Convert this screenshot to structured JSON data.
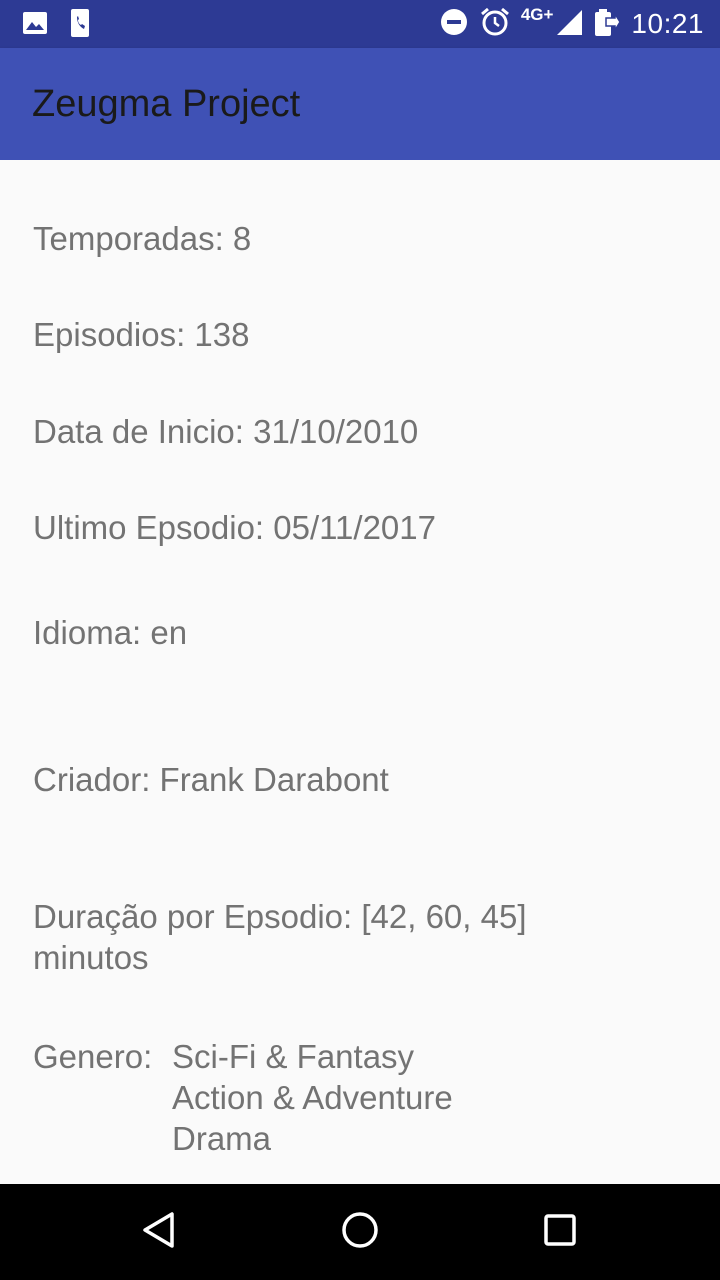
{
  "status_bar": {
    "time": "10:21",
    "network": "4G+",
    "icons": [
      "gallery-icon",
      "phone-file-icon",
      "do-not-disturb-icon",
      "alarm-icon",
      "signal-icon",
      "battery-charging-icon"
    ]
  },
  "app_bar": {
    "title": "Zeugma Project",
    "color": "#3f51b5",
    "status_color": "#2d3a94"
  },
  "details": {
    "seasons": "Temporadas: 8",
    "episodes": "Episodios: 138",
    "start_date": "Data de Inicio: 31/10/2010",
    "last_episode": "Ultimo Epsodio: 05/11/2017",
    "language": "Idioma: en",
    "creator": "Criador: Frank Darabont",
    "duration_line1": "Duração por Epsodio: [42, 60, 45]",
    "duration_line2": "minutos",
    "genre_label": "Genero:",
    "genres": [
      "Sci-Fi & Fantasy",
      "Action & Adventure",
      "Drama"
    ]
  },
  "nav_bar": {
    "icons": [
      "back-icon",
      "home-icon",
      "recents-icon"
    ]
  }
}
